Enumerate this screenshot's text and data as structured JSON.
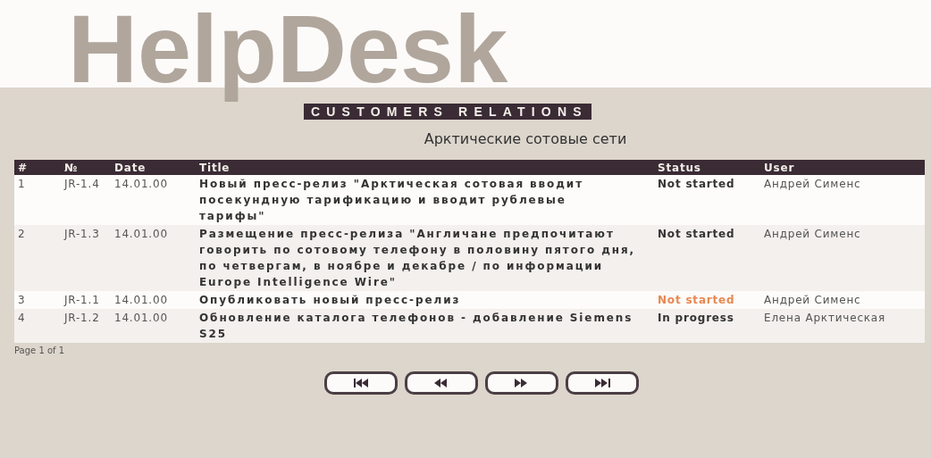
{
  "logo": {
    "title": "HelpDesk",
    "tagline": "CUSTOMERS RELATIONS"
  },
  "subtitle": "Арктические сотовые сети",
  "table": {
    "columns": [
      "#",
      "№",
      "Date",
      "Title",
      "Status",
      "User"
    ],
    "rows": [
      {
        "cells": [
          "1",
          "JR-1.4",
          "14.01.00",
          "Новый пресс-релиз \"Арктическая сотовая вводит посекундную тарификацию и вводит рублевые тарифы\""
        ],
        "status": {
          "label": "Not started",
          "color": "#333333"
        },
        "user": "Андрей Сименс"
      },
      {
        "cells": [
          "2",
          "JR-1.3",
          "14.01.00",
          "Размещение пресс-релиза \"Англичане предпочитают говорить по сотовому телефону в половину пятого дня, по четвергам, в ноябре и декабре / по информации Europe Intelligence Wire\""
        ],
        "status": {
          "label": "Not started",
          "color": "#333333"
        },
        "user": "Андрей Сименс"
      },
      {
        "cells": [
          "3",
          "JR-1.1",
          "14.01.00",
          "Опубликовать новый пресс-релиз"
        ],
        "status": {
          "label": "Not started",
          "color": "#e8874f"
        },
        "user": "Андрей Сименс"
      },
      {
        "cells": [
          "4",
          "JR-1.2",
          "14.01.00",
          "Обновление каталога телефонов - добавление Siemens S25"
        ],
        "status": {
          "label": "In progress",
          "color": "#333333"
        },
        "user": "Елена Арктическая"
      }
    ]
  },
  "pager": {
    "text": "Page 1 of 1",
    "buttons": [
      {
        "kind": "first"
      },
      {
        "kind": "prev"
      },
      {
        "kind": "next"
      },
      {
        "kind": "last"
      }
    ]
  }
}
